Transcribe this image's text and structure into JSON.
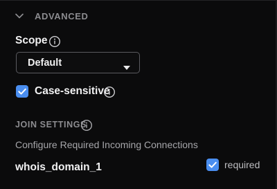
{
  "advanced": {
    "title": "ADVANCED",
    "collapse_icon": "chevron-down-icon"
  },
  "scope": {
    "label": "Scope",
    "info_icon": "info-icon",
    "selected": "Default",
    "dropdown_icon": "caret-down-icon"
  },
  "case_sensitive": {
    "label": "Case-sensitive",
    "checked": true,
    "info_icon": "info-icon"
  },
  "join_settings": {
    "title": "JOIN SETTINGS",
    "info_icon": "info-icon",
    "description": "Configure Required Incoming Connections",
    "connections": [
      {
        "name": "whois_domain_1",
        "required_label": "required",
        "required": true
      }
    ]
  },
  "colors": {
    "background": "#0b0b0c",
    "accent": "#4a8ef0",
    "muted_text": "#8c8c90",
    "primary_text": "#f1f1f2",
    "border": "#5b5b60"
  }
}
